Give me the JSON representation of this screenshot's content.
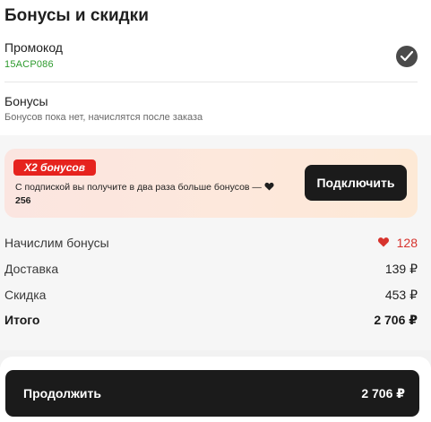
{
  "section": {
    "title": "Бонусы и скидки",
    "promo": {
      "label": "Промокод",
      "code": "15ACP086"
    },
    "bonuses": {
      "label": "Бонусы",
      "subtitle": "Бонусов пока нет, начислятся после заказа"
    }
  },
  "promo_card": {
    "badge": "X2 бонусов",
    "text": "С подпиской вы получите в два раза больше бонусов —",
    "amount": "256",
    "button_label": "Подключить"
  },
  "summary": {
    "bonus_label": "Начислим бонусы",
    "bonus_value": "128",
    "delivery_label": "Доставка",
    "delivery_value": "139 ₽",
    "discount_label": "Скидка",
    "discount_value": "453 ₽",
    "total_label": "Итого",
    "total_value": "2 706 ₽"
  },
  "footer": {
    "button_label": "Продолжить",
    "button_total": "2 706 ₽"
  },
  "colors": {
    "accent": "#e6231e",
    "promo_code": "#2d9a2d",
    "button_bg": "#1b1b1b"
  },
  "icons": [
    "check-icon",
    "heart-icon"
  ]
}
